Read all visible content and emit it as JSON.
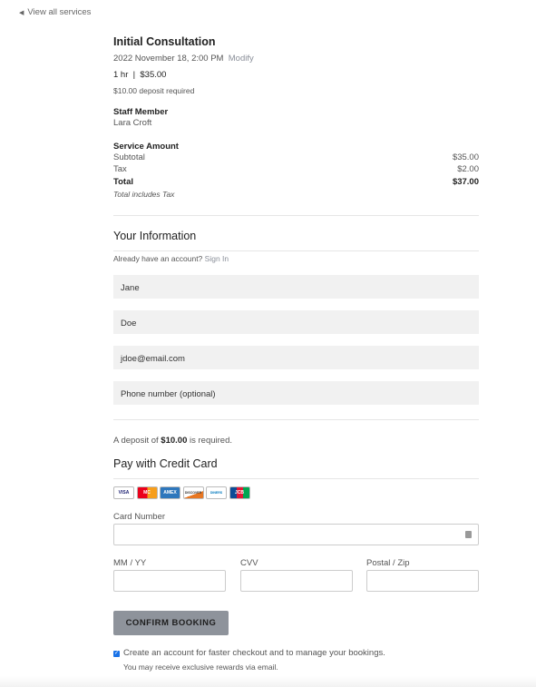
{
  "nav": {
    "back_label": "View all services"
  },
  "service": {
    "title": "Initial Consultation",
    "datetime": "2022 November 18, 2:00 PM",
    "modify": "Modify",
    "duration_price": "1 hr  |  $35.00",
    "deposit_note": "$10.00 deposit required"
  },
  "staff": {
    "heading": "Staff Member",
    "name": "Lara Croft"
  },
  "amount": {
    "heading": "Service Amount",
    "subtotal_label": "Subtotal",
    "subtotal": "$35.00",
    "tax_label": "Tax",
    "tax": "$2.00",
    "total_label": "Total",
    "total": "$37.00",
    "note": "Total includes Tax"
  },
  "info": {
    "heading": "Your Information",
    "account_prompt": "Already have an account?",
    "sign_in": "Sign In",
    "first_name": "Jane",
    "last_name": "Doe",
    "email": "jdoe@email.com",
    "phone_placeholder": "Phone number (optional)"
  },
  "deposit": {
    "prefix": "A deposit of",
    "amount": "$10.00",
    "suffix": "is required."
  },
  "payment": {
    "heading": "Pay with Credit Card",
    "cards": [
      "VISA",
      "MC",
      "AMEX",
      "DISCOVER",
      "DINERS",
      "JCB"
    ],
    "card_number_label": "Card Number",
    "expiry_label": "MM / YY",
    "cvv_label": "CVV",
    "postal_label": "Postal / Zip"
  },
  "actions": {
    "confirm": "CONFIRM BOOKING",
    "create_account": "Create an account for faster checkout and to manage your bookings.",
    "rewards": "You may receive exclusive rewards via email.",
    "create_account_checked": true
  },
  "colors": {
    "link": "#8a8f99",
    "button_bg": "#8e939b",
    "checkbox": "#1a73e8"
  }
}
